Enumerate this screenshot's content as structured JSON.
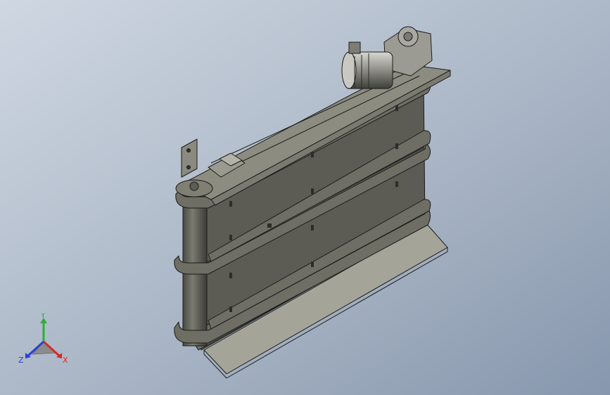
{
  "viewport": {
    "background_top": "#c9d2de",
    "background_bottom": "#8e9db1"
  },
  "model": {
    "body_color": "#5b5b54",
    "frame_color": "#717166",
    "edge_color": "#1c1c1a",
    "plate_color": "#a5a59a",
    "motor_color": "#8a8a84"
  },
  "triad": {
    "x_label": "X",
    "y_label": "Y",
    "z_label": "Z",
    "x_color": "#d42a2a",
    "y_color": "#2fae3a",
    "z_color": "#2a3fd4"
  }
}
